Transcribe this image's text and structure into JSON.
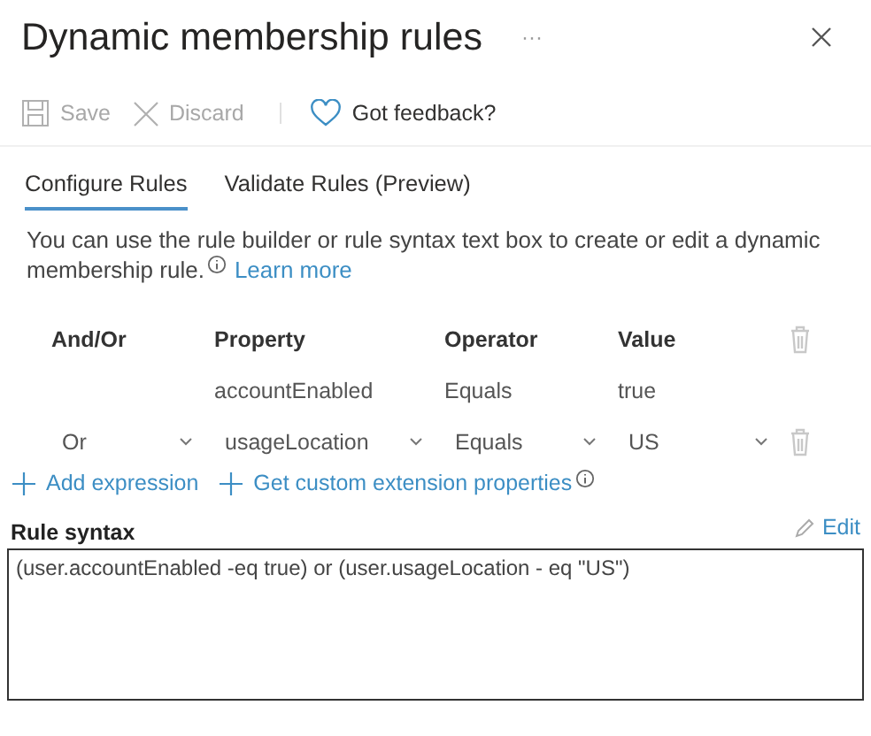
{
  "title": "Dynamic membership rules",
  "more": "···",
  "toolbar": [
    {
      "kind": "save",
      "label": "Save",
      "disabled": true
    },
    {
      "kind": "discard",
      "label": "Discard",
      "disabled": true
    },
    {
      "kind": "feedback",
      "label": "Got feedback?",
      "disabled": false
    }
  ],
  "tabs": [
    {
      "label": "Configure Rules",
      "selected": true
    },
    {
      "label": "Validate Rules (Preview)",
      "selected": false
    }
  ],
  "description": "You can use the rule builder or rule syntax text box to create or edit a dynamic membership rule.",
  "learn_more": "Learn more",
  "table": {
    "columns": [
      "And/Or",
      "Property",
      "Operator",
      "Value"
    ],
    "rows": [
      {
        "kind": "fixed",
        "and_or": "",
        "property": "accountEnabled",
        "operator": "Equals",
        "value": "true"
      },
      {
        "kind": "dropdown",
        "and_or": "Or",
        "property": "usageLocation",
        "operator": "Equals",
        "value": "US"
      }
    ]
  },
  "actions": [
    {
      "label": "Add expression",
      "info": false
    },
    {
      "label": "Get custom extension properties",
      "info": true
    }
  ],
  "rule_syntax": {
    "label": "Rule syntax",
    "edit": "Edit",
    "value": "(user.accountEnabled -eq true) or (user.usageLocation - eq \"US\")"
  }
}
